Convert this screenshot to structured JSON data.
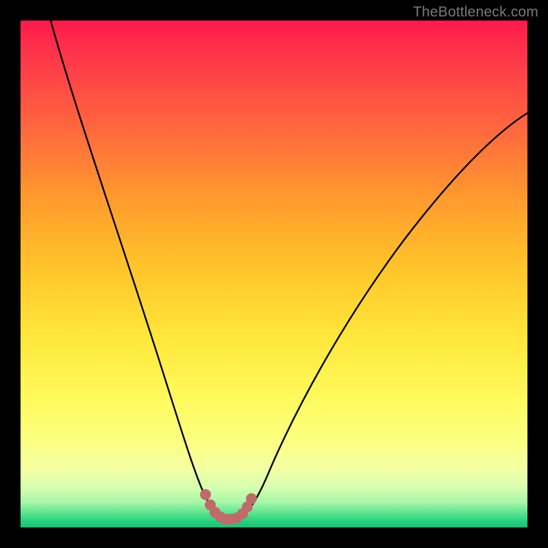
{
  "watermark": "TheBottleneck.com",
  "chart_data": {
    "type": "line",
    "title": "",
    "xlabel": "",
    "ylabel": "",
    "xlim": [
      0,
      100
    ],
    "ylim": [
      0,
      100
    ],
    "grid": false,
    "legend": false,
    "background_gradient": {
      "direction": "vertical",
      "stops": [
        {
          "pct": 0,
          "color": "#ff1a4a",
          "meaning": "high-bottleneck"
        },
        {
          "pct": 50,
          "color": "#ffd83a",
          "meaning": "mid"
        },
        {
          "pct": 100,
          "color": "#12c574",
          "meaning": "no-bottleneck"
        }
      ]
    },
    "series": [
      {
        "name": "bottleneck-curve",
        "stroke": "#000000",
        "x": [
          6,
          10,
          15,
          20,
          25,
          30,
          33,
          35,
          37,
          38,
          39,
          40,
          41,
          42,
          43,
          44,
          45,
          47,
          50,
          55,
          60,
          65,
          70,
          80,
          90,
          100
        ],
        "y": [
          100,
          90,
          78,
          65,
          50,
          33,
          22,
          14,
          8,
          5,
          3,
          2,
          1.5,
          1.5,
          2,
          3,
          5,
          10,
          18,
          30,
          40,
          48,
          54,
          63,
          69,
          73
        ]
      },
      {
        "name": "valley-marker-dots",
        "stroke": "#c96a6a",
        "marker": "circle",
        "x": [
          36.5,
          37.5,
          38.5,
          39.5,
          40.5,
          41.5,
          42.5,
          43.5,
          44.2,
          44.8
        ],
        "y": [
          6.5,
          4.0,
          2.4,
          1.8,
          1.5,
          1.5,
          1.8,
          2.5,
          4.0,
          6.0
        ]
      }
    ],
    "annotations": []
  }
}
